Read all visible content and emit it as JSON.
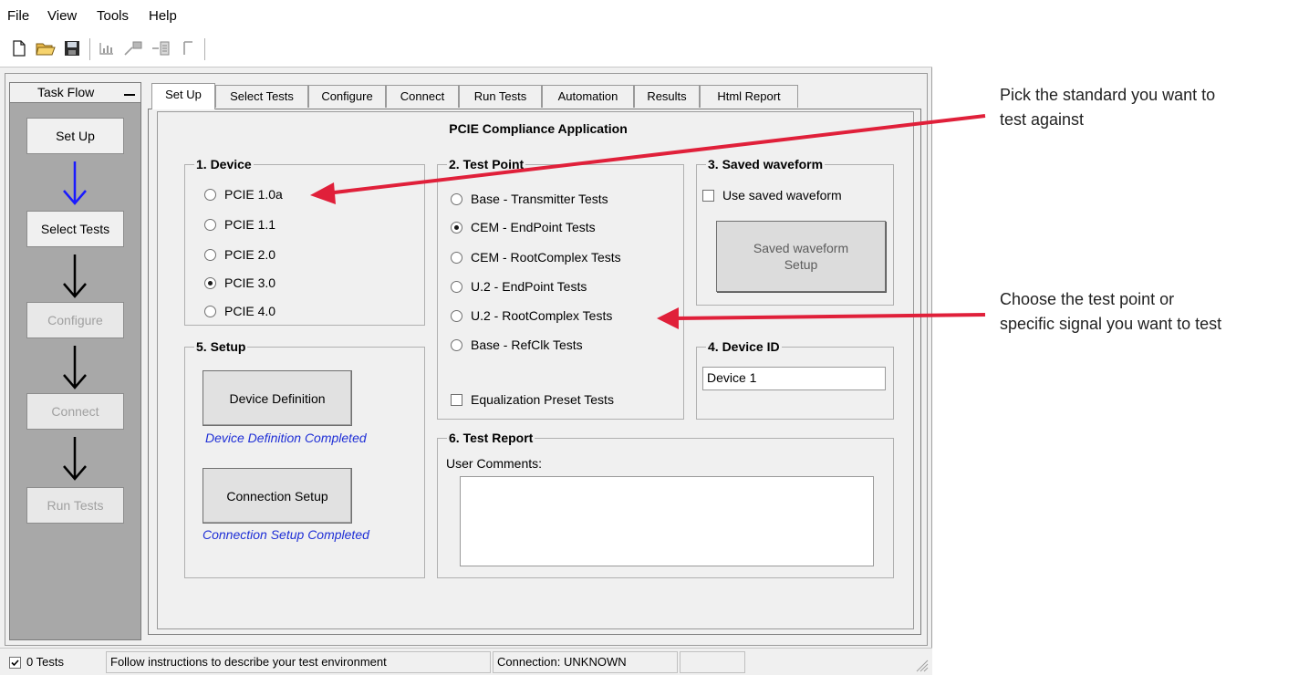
{
  "menu": [
    "File",
    "View",
    "Tools",
    "Help"
  ],
  "toolbar": {
    "icons": [
      "new-document-icon",
      "open-folder-icon",
      "save-disk-icon",
      "chart-icon",
      "export-icon",
      "report-icon",
      "bracket-icon"
    ]
  },
  "task_flow": {
    "title": "Task Flow",
    "items": [
      {
        "label": "Set Up",
        "enabled": true
      },
      {
        "label": "Select Tests",
        "enabled": true
      },
      {
        "label": "Configure",
        "enabled": false
      },
      {
        "label": "Connect",
        "enabled": false
      },
      {
        "label": "Run Tests",
        "enabled": false
      }
    ],
    "active_arrow_color": "#1a1aff",
    "arrow_color": "#000000"
  },
  "tabs": [
    "Set Up",
    "Select Tests",
    "Configure",
    "Connect",
    "Run Tests",
    "Automation",
    "Results",
    "Html Report"
  ],
  "active_tab": "Set Up",
  "app_title": "PCIE Compliance Application",
  "device_group": {
    "title": "1. Device",
    "options": [
      "PCIE 1.0a",
      "PCIE 1.1",
      "PCIE 2.0",
      "PCIE 3.0",
      "PCIE 4.0"
    ],
    "selected": "PCIE 3.0"
  },
  "test_point_group": {
    "title": "2. Test Point",
    "options": [
      "Base - Transmitter Tests",
      "CEM - EndPoint Tests",
      "CEM - RootComplex Tests",
      "U.2 - EndPoint Tests",
      "U.2 - RootComplex Tests",
      "Base - RefClk Tests"
    ],
    "selected": "CEM - EndPoint Tests",
    "checkbox_label": "Equalization Preset Tests"
  },
  "saved_waveform_group": {
    "title": "3. Saved waveform",
    "checkbox_label": "Use saved waveform",
    "button_label": "Saved waveform Setup"
  },
  "device_id_group": {
    "title": "4. Device ID",
    "value": "Device 1"
  },
  "setup_group": {
    "title": "5. Setup",
    "device_definition_button": "Device Definition",
    "device_definition_status": "Device Definition Completed",
    "connection_setup_button": "Connection Setup",
    "connection_setup_status": "Connection Setup Completed"
  },
  "test_report_group": {
    "title": "6. Test Report",
    "comments_label": "User Comments:",
    "comments_value": ""
  },
  "status_bar": {
    "tests": "0 Tests",
    "message": "Follow instructions to describe your test environment",
    "connection": "Connection: UNKNOWN"
  },
  "annotations": {
    "standard": [
      "Pick the standard you want to",
      "test against"
    ],
    "test_point": [
      "Choose the test point or",
      "specific signal you want to test"
    ],
    "arrow_color": "#e0203a"
  }
}
